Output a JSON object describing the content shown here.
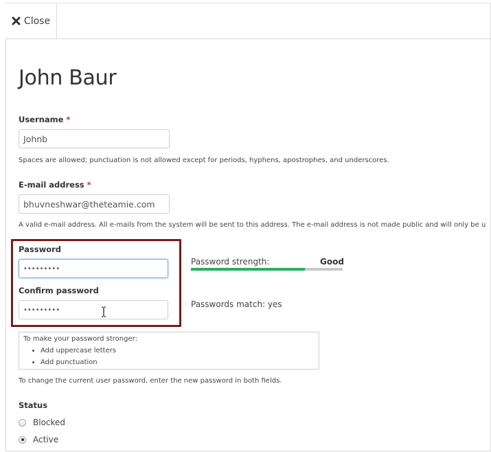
{
  "toolbar": {
    "close_label": "Close"
  },
  "page": {
    "title": "John Baur"
  },
  "form": {
    "username": {
      "label": "Username",
      "required_mark": "*",
      "value": "Johnb",
      "description": "Spaces are allowed; punctuation is not allowed except for periods, hyphens, apostrophes, and underscores."
    },
    "email": {
      "label": "E-mail address",
      "required_mark": "*",
      "value": "bhuvneshwar@theteamie.com",
      "description": "A valid e-mail address. All e-mails from the system will be sent to this address. The e-mail address is not made public and will only be used"
    },
    "password": {
      "label": "Password",
      "value": "•••••••••"
    },
    "confirm_password": {
      "label": "Confirm password",
      "value": "•••••••••"
    },
    "strength": {
      "label": "Password strength:",
      "value": "Good",
      "level": 0.75,
      "color": "#27ae60"
    },
    "match": {
      "text": "Passwords match: yes"
    },
    "suggestions": {
      "title": "To make your password stronger:",
      "items": [
        "Add uppercase letters",
        "Add punctuation"
      ]
    },
    "password_help": "To change the current user password, enter the new password in both fields.",
    "status": {
      "label": "Status",
      "options": [
        {
          "label": "Blocked",
          "checked": false
        },
        {
          "label": "Active",
          "checked": true
        }
      ]
    }
  },
  "colors": {
    "highlight_border": "#7b1a1a",
    "focus_border": "#66afe9",
    "required": "#c0392b"
  }
}
